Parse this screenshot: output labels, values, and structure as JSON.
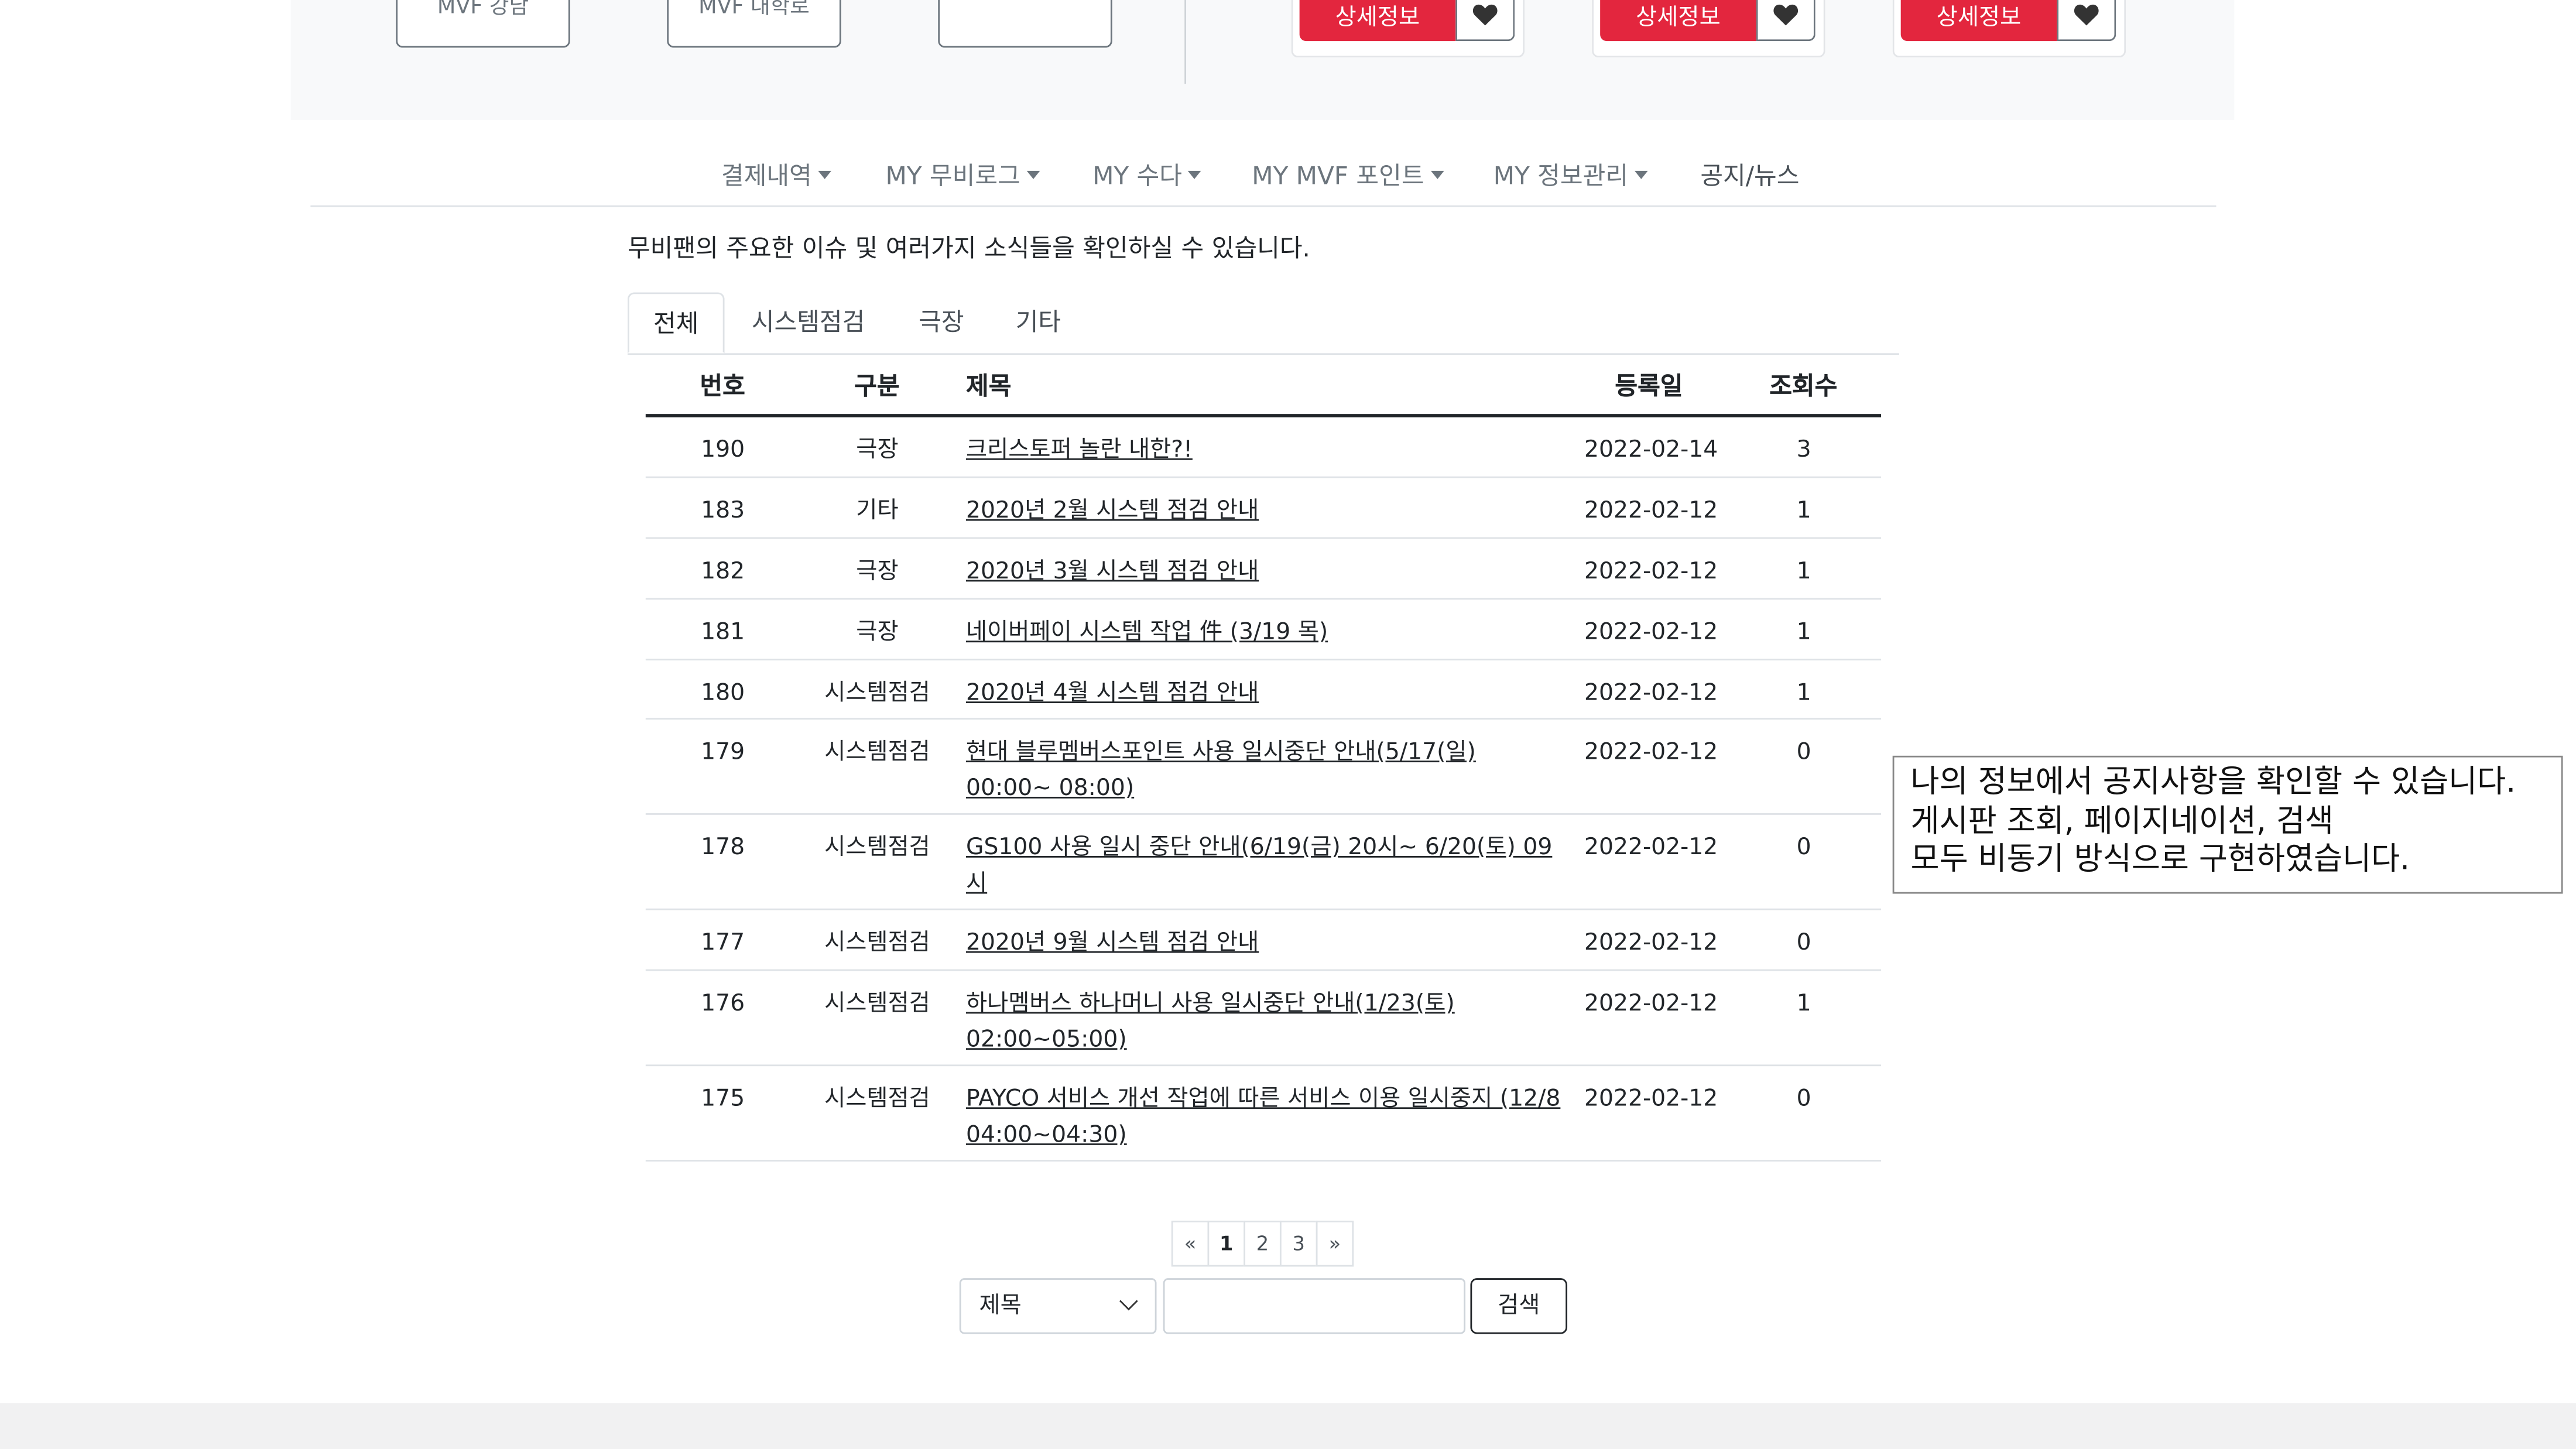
{
  "top_panel": {
    "cinema_buttons": [
      "MVF 강남",
      "MVF 대학로",
      ""
    ],
    "card_buttons": [
      {
        "detail_label": "상세정보"
      },
      {
        "detail_label": "상세정보"
      },
      {
        "detail_label": "상세정보"
      }
    ]
  },
  "nav": {
    "items": [
      {
        "label": "결제내역",
        "dropdown": true
      },
      {
        "label": "MY 무비로그",
        "dropdown": true
      },
      {
        "label": "MY 수다",
        "dropdown": true
      },
      {
        "label": "MY MVF 포인트",
        "dropdown": true
      },
      {
        "label": "MY 정보관리",
        "dropdown": true
      },
      {
        "label": "공지/뉴스",
        "dropdown": false,
        "active": true
      }
    ]
  },
  "intro_text": "무비팬의 주요한 이슈 및 여러가지 소식들을 확인하실 수 있습니다.",
  "tabs": [
    {
      "label": "전체",
      "active": true
    },
    {
      "label": "시스템점검"
    },
    {
      "label": "극장"
    },
    {
      "label": "기타"
    }
  ],
  "table": {
    "headers": {
      "num": "번호",
      "category": "구분",
      "title": "제목",
      "date": "등록일",
      "views": "조회수"
    },
    "rows": [
      {
        "num": "190",
        "category": "극장",
        "title": "크리스토퍼 놀란 내한?!",
        "date": "2022-02-14",
        "views": "3"
      },
      {
        "num": "183",
        "category": "기타",
        "title": "2020년 2월 시스템 점검 안내",
        "date": "2022-02-12",
        "views": "1"
      },
      {
        "num": "182",
        "category": "극장",
        "title": "2020년 3월 시스템 점검 안내",
        "date": "2022-02-12",
        "views": "1"
      },
      {
        "num": "181",
        "category": "극장",
        "title": "네이버페이 시스템 작업 件 (3/19 목)",
        "date": "2022-02-12",
        "views": "1"
      },
      {
        "num": "180",
        "category": "시스템점검",
        "title": "2020년 4월 시스템 점검 안내",
        "date": "2022-02-12",
        "views": "1"
      },
      {
        "num": "179",
        "category": "시스템점검",
        "title": "현대 블루멤버스포인트 사용 일시중단 안내(5/17(일) 00:00~ 08:00)",
        "date": "2022-02-12",
        "views": "0"
      },
      {
        "num": "178",
        "category": "시스템점검",
        "title": "GS100 사용 일시 중단 안내(6/19(금) 20시~ 6/20(토) 09시",
        "date": "2022-02-12",
        "views": "0"
      },
      {
        "num": "177",
        "category": "시스템점검",
        "title": "2020년 9월 시스템 점검 안내",
        "date": "2022-02-12",
        "views": "0"
      },
      {
        "num": "176",
        "category": "시스템점검",
        "title": "하나멤버스 하나머니 사용 일시중단 안내(1/23(토) 02:00~05:00)",
        "date": "2022-02-12",
        "views": "1"
      },
      {
        "num": "175",
        "category": "시스템점검",
        "title": "PAYCO 서비스 개선 작업에 따른 서비스 이용 일시중지 (12/8 04:00~04:30)",
        "date": "2022-02-12",
        "views": "0"
      }
    ]
  },
  "callout": {
    "line1": "나의 정보에서 공지사항을 확인할 수 있습니다.",
    "line2": "게시판 조회, 페이지네이션, 검색",
    "line3": "모두 비동기 방식으로 구현하였습니다."
  },
  "pagination": {
    "prev": "«",
    "pages": [
      "1",
      "2",
      "3"
    ],
    "current": "1",
    "next": "»"
  },
  "search": {
    "select_value": "제목",
    "input_value": "",
    "button_label": "검색"
  },
  "colors": {
    "accent": "#e3263e",
    "border": "#dee2e6",
    "muted": "#6c757d"
  }
}
